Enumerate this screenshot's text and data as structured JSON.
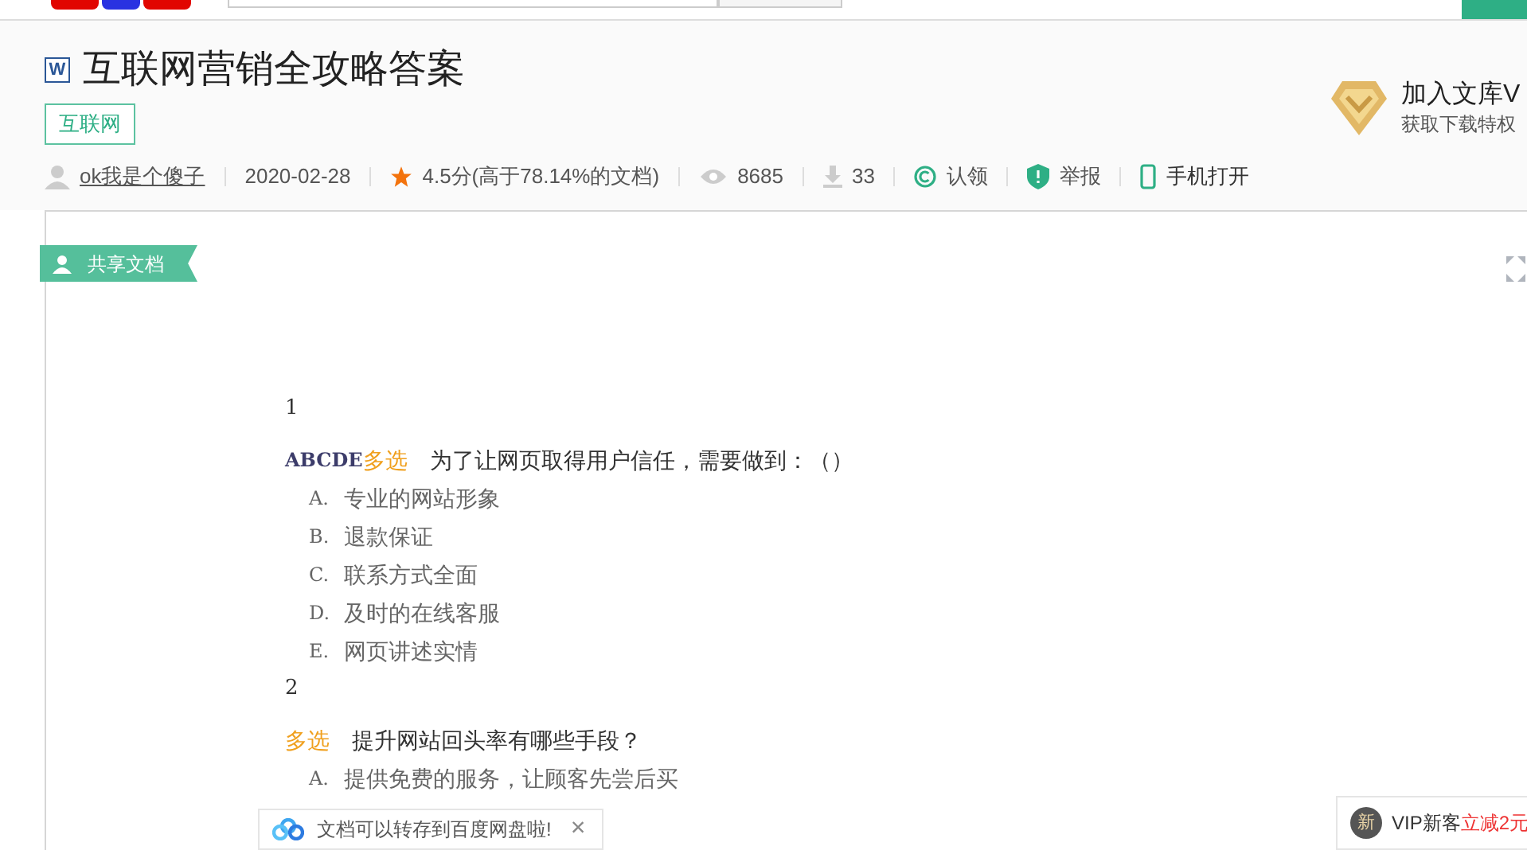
{
  "doc": {
    "file_icon": "W",
    "title": "互联网营销全攻略答案",
    "tag": "互联网"
  },
  "vip": {
    "title": "加入文库V",
    "subtitle": "获取下载特权"
  },
  "meta": [
    {
      "kind": "author",
      "text": "ok我是个傻子"
    },
    {
      "kind": "date",
      "text": "2020-02-28"
    },
    {
      "kind": "rating",
      "text": "4.5分(高于78.14%的文档)"
    },
    {
      "kind": "views",
      "text": "8685"
    },
    {
      "kind": "downloads",
      "text": "33"
    },
    {
      "kind": "claim",
      "text": "认领"
    },
    {
      "kind": "report",
      "text": "举报"
    },
    {
      "kind": "mobile",
      "text": "手机打开"
    }
  ],
  "badge": "共享文档",
  "questions": [
    {
      "number": "1",
      "answer": "ABCDE",
      "type": "多选",
      "text": "为了让网页取得用户信任，需要做到：（）",
      "options": [
        {
          "letter": "A.",
          "text": "专业的网站形象"
        },
        {
          "letter": "B.",
          "text": "退款保证"
        },
        {
          "letter": "C.",
          "text": "联系方式全面"
        },
        {
          "letter": "D.",
          "text": "及时的在线客服"
        },
        {
          "letter": "E.",
          "text": "网页讲述实情"
        }
      ]
    },
    {
      "number": "2",
      "type": "多选",
      "text": "提升网站回头率有哪些手段？",
      "options": [
        {
          "letter": "A.",
          "text": "提供免费的服务，让顾客先尝后买"
        }
      ]
    }
  ],
  "toast": {
    "text": "文档可以转存到百度网盘啦!",
    "close": "×"
  },
  "promo": {
    "icon": "新",
    "text": "VIP新客",
    "highlight": "立减2元"
  }
}
